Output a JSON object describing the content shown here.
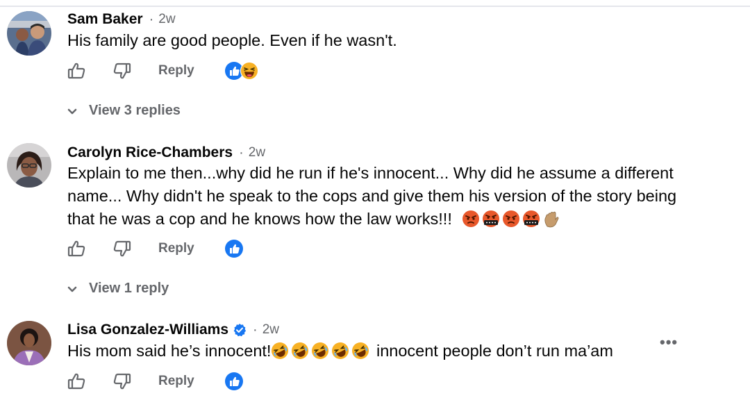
{
  "comments": [
    {
      "author": "Sam Baker",
      "separator": "·",
      "time": "2w",
      "text_lines": [
        "His family are good people. Even if he wasn't."
      ],
      "emojis": [],
      "reply_label": "Reply",
      "reactions": [
        "like",
        "haha"
      ],
      "view_replies": "View 3 replies",
      "verified": false
    },
    {
      "author": "Carolyn Rice-Chambers",
      "separator": "·",
      "time": "2w",
      "text_lines": [
        "Explain to me then...why did he run if he's innocent... Why did he assume a different",
        "name... Why didn't he speak to the cops and give them his version of the story being",
        "that he was a cop and he knows how the law works!!!"
      ],
      "emojis": [
        "angry-face",
        "cursing-face",
        "angry-face",
        "cursing-face",
        "waving-hand"
      ],
      "reply_label": "Reply",
      "reactions": [
        "like"
      ],
      "view_replies": "View 1 reply",
      "verified": false
    },
    {
      "author": "Lisa Gonzalez-Williams",
      "separator": "·",
      "time": "2w",
      "text_before": "His mom said he’s innocent!",
      "emojis": [
        "rolling-laughing",
        "rolling-laughing",
        "rolling-laughing",
        "rolling-laughing",
        "rolling-laughing"
      ],
      "text_after": " innocent people don’t run ma’am",
      "reply_label": "Reply",
      "reactions": [
        "like"
      ],
      "more_label": "•••",
      "verified": true
    }
  ],
  "colors": {
    "secondary_text": "#65676b",
    "like_blue": "#1877f2",
    "haha_yellow": "#f7b125",
    "divider": "#e4e6eb"
  }
}
